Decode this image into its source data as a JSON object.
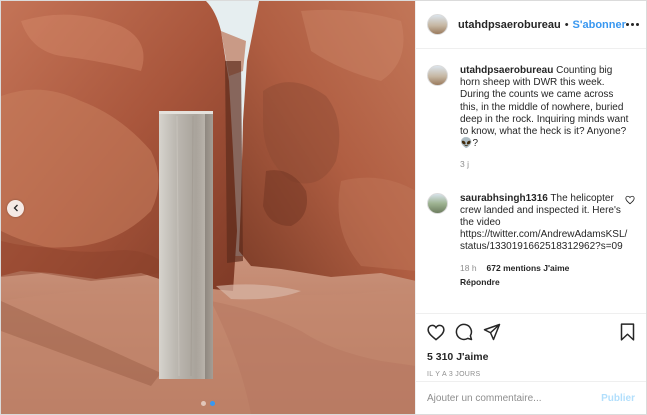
{
  "post": {
    "username": "utahdpsaerobureau",
    "separator": "•",
    "follow_label": "S'abonner",
    "more_icon": "more-horizontal-icon"
  },
  "comments": [
    {
      "username": "utahdpsaerobureau",
      "text": "Counting big horn sheep with DWR this week. During the counts we came across this, in the middle of nowhere, buried deep in the rock. Inquiring minds want to know, what the heck is it? Anyone? 👽?",
      "time": "3 j"
    },
    {
      "username": "saurabhsingh1316",
      "text": "The helicopter crew landed and inspected it. Here's the video https://twitter.com/AndrewAdamsKSL/status/1330191662518312962?s=09",
      "time": "18 h",
      "likes": "672 mentions J'aime",
      "reply": "Répondre"
    }
  ],
  "actions": {
    "like_icon": "heart-icon",
    "comment_icon": "comment-icon",
    "share_icon": "share-icon",
    "save_icon": "bookmark-icon",
    "likes_count": "5 310 J'aime",
    "time_ago": "IL Y A 3 JOURS"
  },
  "add_comment": {
    "placeholder": "Ajouter un commentaire...",
    "post_label": "Publier"
  },
  "colors": {
    "accent": "#3897f0",
    "rock": "#b5644a",
    "sky": "#e6eef0",
    "monolith": "#b9b7b2"
  }
}
